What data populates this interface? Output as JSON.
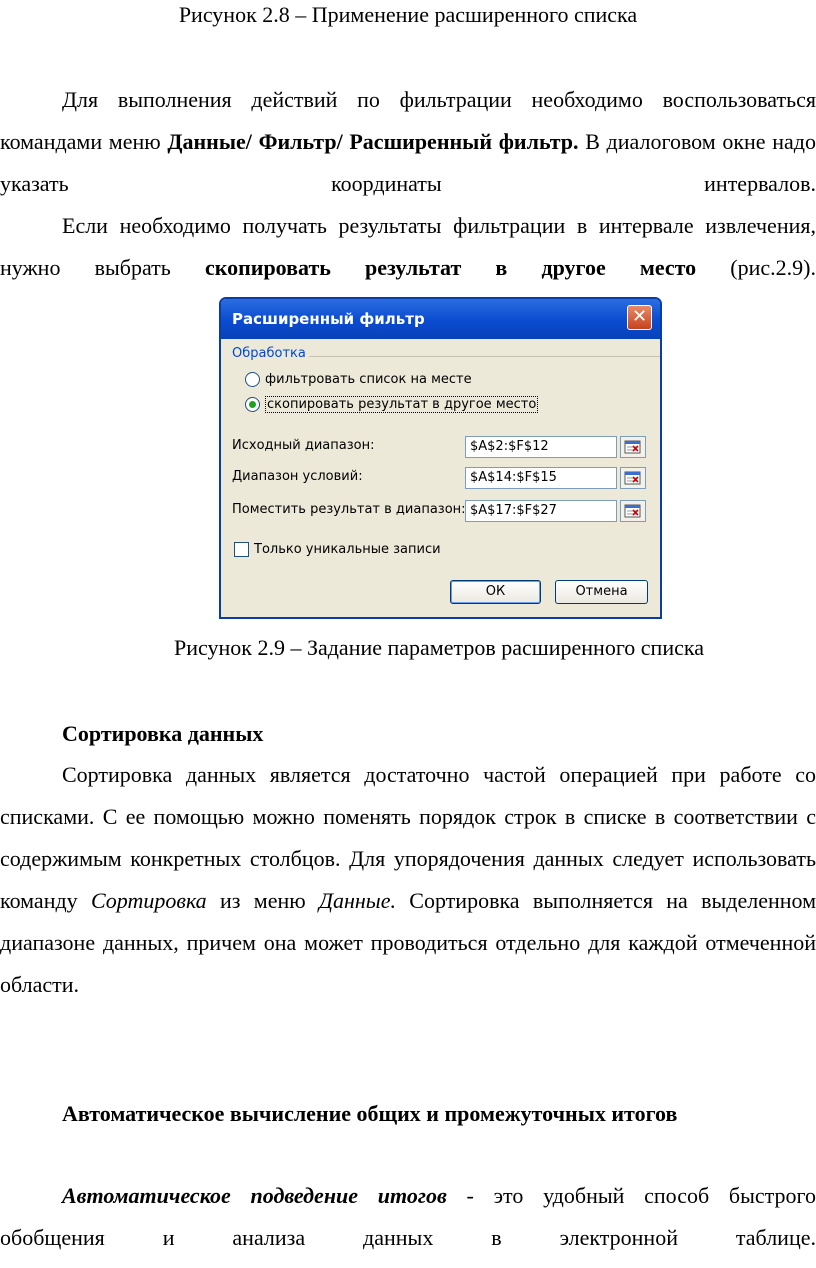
{
  "fig28_caption": "Рисунок 2.8 – Применение расширенного списка",
  "para1": {
    "t1": "Для выполнения действий по фильтрации необходимо воспользоваться командами меню ",
    "bold": "Данные/ Фильтр/ Расширенный фильтр.",
    "t2": " В диалоговом окне надо указать координаты интервалов."
  },
  "para2": {
    "t1": "Если необходимо получать результаты фильтрации в интервале извлечения, нужно выбрать ",
    "bold": "скопировать результат в другое место",
    "t2": " (рис.2.9)."
  },
  "dialog": {
    "title": "Расширенный фильтр",
    "close": "✕",
    "group_label": "Обработка",
    "radio1": "фильтровать список на месте",
    "radio2": "скопировать результат в другое место",
    "radio_selected": 2,
    "source_label": "Исходный диапазон:",
    "source_value": "$A$2:$F$12",
    "criteria_label": "Диапазон условий:",
    "criteria_value": "$A$14:$F$15",
    "output_label": "Поместить результат в диапазон:",
    "output_value": "$A$17:$F$27",
    "unique_label": "Только уникальные записи",
    "unique_checked": false,
    "ok": "ОК",
    "cancel": "Отмена"
  },
  "fig29_caption": "Рисунок 2.9 – Задание параметров расширенного списка",
  "heading_sort": "Сортировка данных",
  "para3": {
    "t1": "Сортировка данных является достаточно частой операцией при работе со списками. С ее помощью можно поменять порядок строк в списке в соответствии с содержимым конкретных столбцов. Для упорядочения данных следует использовать команду ",
    "it1": "Сортировка",
    "t2": " из меню ",
    "it2": "Данные.",
    "t3": " Сортировка выполняется на выделенном диапазоне данных, причем она может проводиться отдельно для каждой отмеченной области."
  },
  "heading_totals": "Автоматическое вычисление общих и промежуточных итогов",
  "para4": {
    "bi": "Автоматическое подведение итогов",
    "t1": " - это удобный способ быстрого обобщения и анализа данных в электронной таблице."
  }
}
